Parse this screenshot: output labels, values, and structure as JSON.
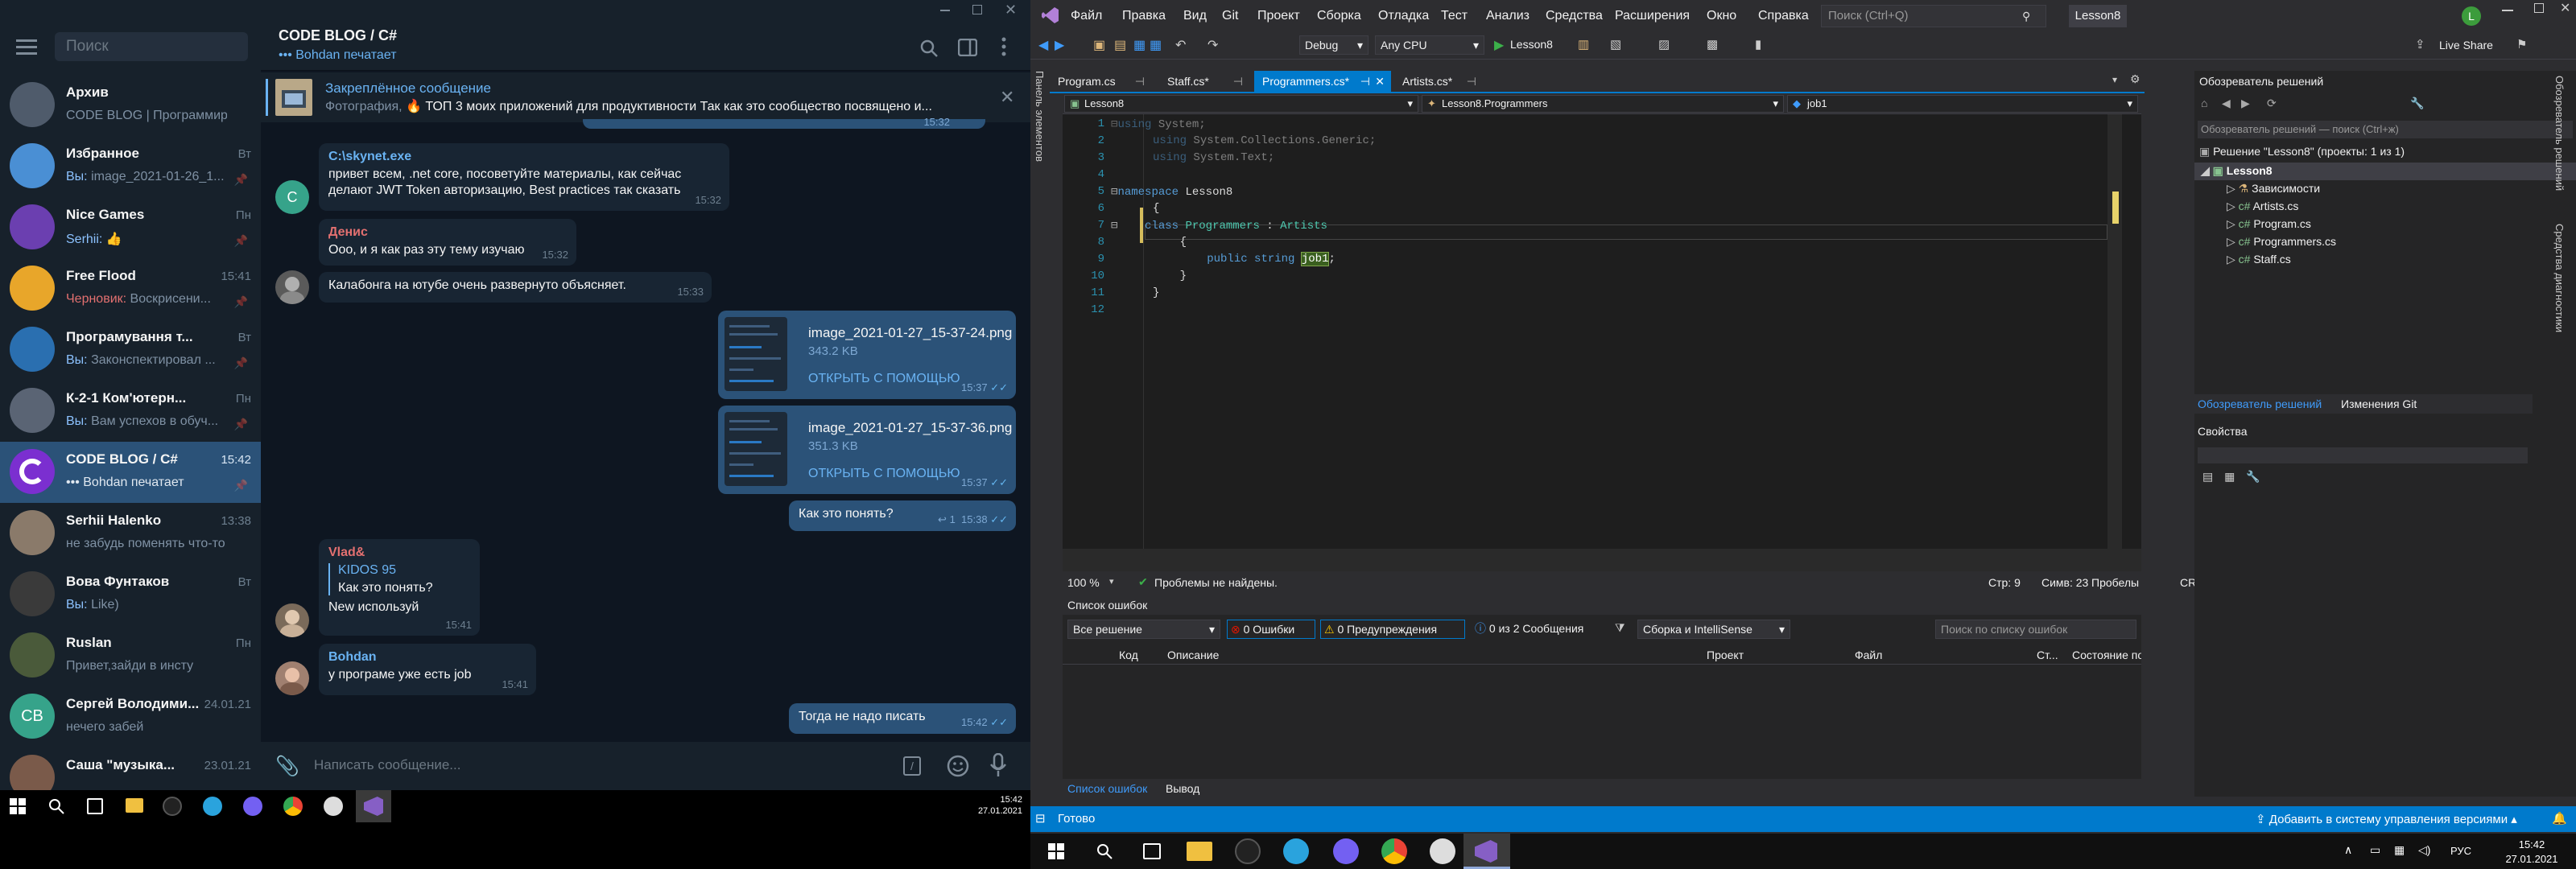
{
  "telegram": {
    "search_placeholder": "Поиск",
    "chats": [
      {
        "name": "Архив",
        "preview": "CODE BLOG | Программир...",
        "time": "",
        "avatar_color": "#4f5b6b"
      },
      {
        "name": "Избранное",
        "preview_prefix": "Вы: ",
        "preview": "image_2021-01-26_1...",
        "time": "Вт",
        "avatar_color": "#4a8fd4"
      },
      {
        "name": "Nice Games",
        "preview_prefix": "Serhii: ",
        "preview": "👍",
        "time": "Пн",
        "avatar_color": "#6b3fb0"
      },
      {
        "name": "Free Flood",
        "preview_prefix": "Черновик: ",
        "preview": "Воскрисени...",
        "time": "15:41",
        "avatar_color": "#e8a62a"
      },
      {
        "name": "Програмування т...",
        "preview_prefix": "Вы: ",
        "preview": "Законспектировал ...",
        "time": "Вт",
        "avatar_color": "#2a6fb0"
      },
      {
        "name": "К-2-1 Ком'ютерн...",
        "preview_prefix": "Вы: ",
        "preview": "Вам успехов в обуч...",
        "time": "Пн",
        "avatar_color": "#5a6474"
      },
      {
        "name": "CODE BLOG / C#",
        "preview": "••• Bohdan печатает",
        "time": "15:42",
        "avatar_color": "#7b2fd0"
      },
      {
        "name": "Serhii Halenko",
        "preview": "не забудь поменять что-то",
        "time": "13:38",
        "avatar_color": "#8a7a6a"
      },
      {
        "name": "Вова Фунтаков",
        "preview_prefix": "Вы: ",
        "preview": "Like)",
        "time": "Вт",
        "avatar_color": "#3a3a3a"
      },
      {
        "name": "Ruslan",
        "preview": "Привет,зайди в инсту",
        "time": "Пн",
        "avatar_color": "#4a5a3a"
      },
      {
        "name": "Сергей Володими...",
        "preview": "нечего забей",
        "time": "24.01.21",
        "avatar_color": "#36a38a",
        "initials": "СВ"
      },
      {
        "name": "Саша \"музыка...",
        "preview": "",
        "time": "23.01.21",
        "avatar_color": "#7a5a4a"
      }
    ],
    "chat_title": "CODE BLOG / C#",
    "chat_status": "••• Bohdan печатает",
    "pinned_title": "Закреплённое сообщение",
    "pinned_prefix": "Фотография, ",
    "pinned_text": "🔥 ТОП 3 моих приложений для продуктивности  Так как это сообщество посвящено и...",
    "partial_time": "15:32",
    "messages": [
      {
        "sender": "C:\\skynet.exe",
        "text1": "привет всем, .net core, посоветуйте материалы, как сейчас",
        "text2": "делают JWT Token авторизацию, Best practices так сказать",
        "time": "15:32",
        "initial": "C"
      },
      {
        "sender": "Денис",
        "text1": "Ооо, и я как раз эту тему изучаю",
        "time": "15:32"
      },
      {
        "text1": "Калабонга на ютубе очень развернуто объясняет.",
        "time": "15:33"
      },
      {
        "file": "image_2021-01-27_15-37-24.png",
        "size": "343.2 KB",
        "action": "ОТКРЫТЬ С ПОМОЩЬЮ",
        "time": "15:37"
      },
      {
        "file": "image_2021-01-27_15-37-36.png",
        "size": "351.3 KB",
        "action": "ОТКРЫТЬ С ПОМОЩЬЮ",
        "time": "15:37"
      },
      {
        "text1": "Как это понять?",
        "replies": "1",
        "time": "15:38"
      },
      {
        "sender": "Vlad&",
        "quote_name": "KIDOS 95",
        "quote_text": "Как это понять?",
        "text1": "New используй",
        "time": "15:41"
      },
      {
        "sender": "Bohdan",
        "text1": "у програме уже есть job",
        "time": "15:41"
      },
      {
        "text1": "Тогда не надо писать",
        "time": "15:42"
      }
    ],
    "input_placeholder": "Написать сообщение...",
    "clock_time": "15:42",
    "clock_date": "27.01.2021"
  },
  "vs": {
    "menu": [
      "Файл",
      "Правка",
      "Вид",
      "Git",
      "Проект",
      "Сборка",
      "Отладка",
      "Тест",
      "Анализ",
      "Средства",
      "Расширения",
      "Окно",
      "Справка"
    ],
    "search_placeholder": "Поиск (Ctrl+Q)",
    "solution_name": "Lesson8",
    "avatar_letter": "L",
    "live_share": "Live Share",
    "config": "Debug",
    "platform": "Any CPU",
    "run_target": "Lesson8",
    "left_strip_label": "Панель элементов",
    "tabs": [
      "Program.cs",
      "Staff.cs*",
      "Programmers.cs*",
      "Artists.cs*"
    ],
    "nav": [
      "Lesson8",
      "Lesson8.Programmers",
      "job1"
    ],
    "code_lines": [
      {
        "n": "1",
        "t": "using System;"
      },
      {
        "n": "2",
        "t": "using System.Collections.Generic;"
      },
      {
        "n": "3",
        "t": "using System.Text;"
      },
      {
        "n": "4",
        "t": ""
      },
      {
        "n": "5",
        "t": "namespace Lesson8"
      },
      {
        "n": "6",
        "t": "{"
      },
      {
        "n": "7",
        "t": "class Programmers : Artists"
      },
      {
        "n": "8",
        "t": "{"
      },
      {
        "n": "9",
        "t": "public string job1;"
      },
      {
        "n": "10",
        "t": "}"
      },
      {
        "n": "11",
        "t": "}"
      },
      {
        "n": "12",
        "t": ""
      }
    ],
    "zoom": "100 %",
    "issues": "Проблемы не найдены.",
    "line": "Стр: 9",
    "col": "Симв: 23",
    "spaces": "Пробелы",
    "eol": "CRLF",
    "error_list": {
      "title": "Список ошибок",
      "scope": "Все решение",
      "errors": "0 Ошибки",
      "warnings": "0 Предупреждения",
      "messages": "0 из 2 Сообщения",
      "build_filter": "Сборка и IntelliSense",
      "search_placeholder": "Поиск по списку ошибок",
      "columns": [
        "Код",
        "Описание",
        "Проект",
        "Файл",
        "Ст...",
        "Состояние подавлен"
      ]
    },
    "bottom_tabs": [
      "Список ошибок",
      "Вывод"
    ],
    "solution_explorer": {
      "title": "Обозреватель решений",
      "search_placeholder": "Обозреватель решений — поиск (Ctrl+ж)",
      "solution": "Решение \"Lesson8\" (проекты: 1 из 1)",
      "project": "Lesson8",
      "items": [
        "Зависимости",
        "Artists.cs",
        "Program.cs",
        "Programmers.cs",
        "Staff.cs"
      ],
      "tabs": [
        "Обозреватель решений",
        "Изменения Git"
      ]
    },
    "properties_title": "Свойства",
    "right_strip": [
      "Обозреватель решений",
      "Средства диагностики"
    ],
    "status_ready": "Готово",
    "status_vcs": "Добавить в систему управления версиями",
    "taskbar_lang": "РУС",
    "taskbar_time": "15:42",
    "taskbar_date": "27.01.2021"
  }
}
